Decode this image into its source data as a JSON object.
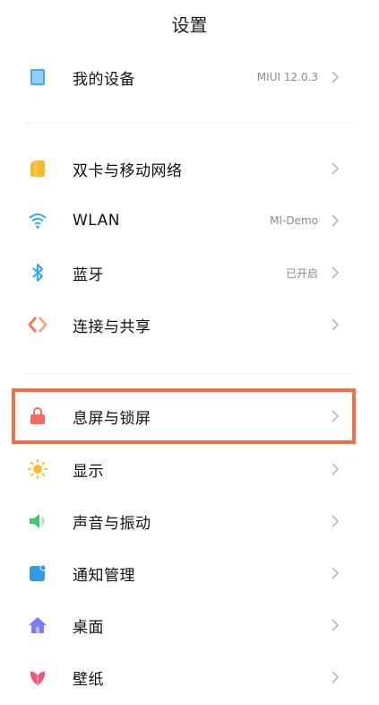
{
  "header": {
    "title": "设置"
  },
  "accent_color": "#f07040",
  "rows": {
    "device": {
      "label": "我的设备",
      "value": "MIUI 12.0.3",
      "icon": "tablet-icon",
      "color": "#4aa8f0"
    },
    "sim": {
      "label": "双卡与移动网络",
      "value": "",
      "icon": "sim-card-icon",
      "color": "#f5bb2b"
    },
    "wlan": {
      "label": "WLAN",
      "value": "MI-Demo",
      "icon": "wifi-icon",
      "color": "#2fa9f4"
    },
    "bt": {
      "label": "蓝牙",
      "value": "已开启",
      "icon": "bluetooth-icon",
      "color": "#2fa9f4"
    },
    "share": {
      "label": "连接与共享",
      "value": "",
      "icon": "share-icon",
      "color": "#f07a5a"
    },
    "lock": {
      "label": "息屏与锁屏",
      "value": "",
      "icon": "lock-icon",
      "color": "#f36c5d"
    },
    "display": {
      "label": "显示",
      "value": "",
      "icon": "sun-icon",
      "color": "#f5c030"
    },
    "sound": {
      "label": "声音与振动",
      "value": "",
      "icon": "speaker-icon",
      "color": "#3ecc6b"
    },
    "notify": {
      "label": "通知管理",
      "value": "",
      "icon": "notification-icon",
      "color": "#2f9be8"
    },
    "desktop": {
      "label": "桌面",
      "value": "",
      "icon": "home-icon",
      "color": "#7b7ef0"
    },
    "wallpaper": {
      "label": "壁纸",
      "value": "",
      "icon": "flower-icon",
      "color": "#f0567a"
    }
  }
}
